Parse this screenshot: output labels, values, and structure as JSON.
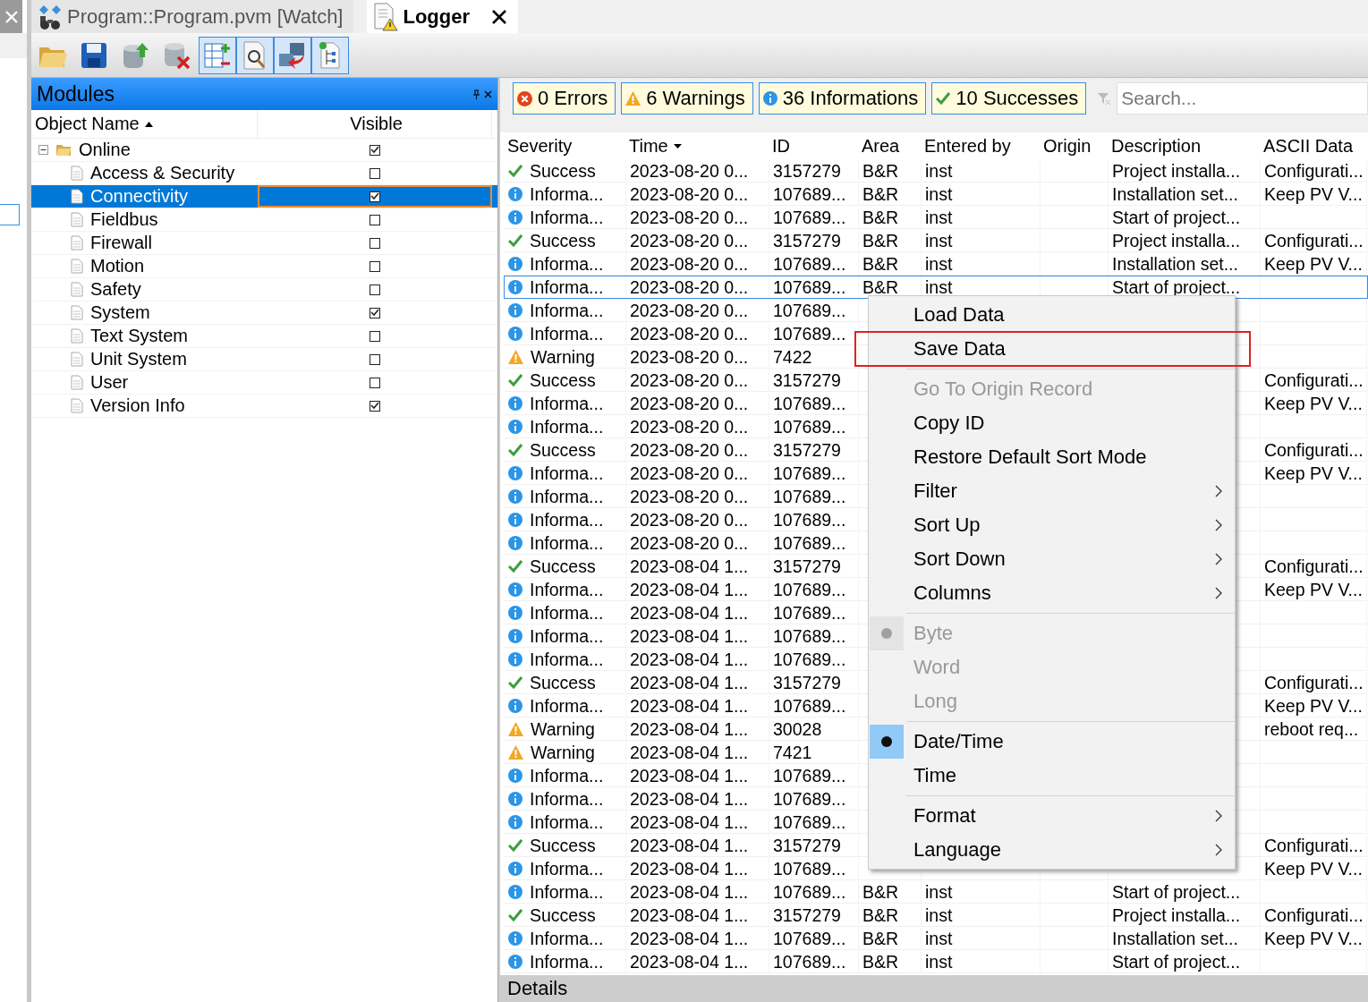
{
  "tabs": [
    {
      "label": "Program::Program.pvm [Watch]",
      "kind": "watch",
      "selected": false
    },
    {
      "label": "Logger",
      "kind": "logger",
      "selected": true
    }
  ],
  "toolbar": [
    {
      "kind": "open",
      "pressed": false
    },
    {
      "kind": "save",
      "pressed": false
    },
    {
      "kind": "upload",
      "pressed": false
    },
    {
      "kind": "delete",
      "pressed": false
    },
    {
      "kind": "columns",
      "pressed": true
    },
    {
      "kind": "find",
      "pressed": true
    },
    {
      "kind": "transfer",
      "pressed": true
    },
    {
      "kind": "tree",
      "pressed": true
    }
  ],
  "modules": {
    "title": "Modules",
    "columns": [
      "Object Name",
      "Visible"
    ],
    "tree": [
      {
        "name": "Online",
        "visible": true,
        "expanded": true,
        "selected": false,
        "children": [
          {
            "name": "Access & Security",
            "visible": false,
            "selected": false
          },
          {
            "name": "Connectivity",
            "visible": true,
            "selected": true
          },
          {
            "name": "Fieldbus",
            "visible": false,
            "selected": false
          },
          {
            "name": "Firewall",
            "visible": false,
            "selected": false
          },
          {
            "name": "Motion",
            "visible": false,
            "selected": false
          },
          {
            "name": "Safety",
            "visible": false,
            "selected": false
          },
          {
            "name": "System",
            "visible": true,
            "selected": false
          },
          {
            "name": "Text System",
            "visible": false,
            "selected": false
          },
          {
            "name": "Unit System",
            "visible": false,
            "selected": false
          },
          {
            "name": "User",
            "visible": false,
            "selected": false
          },
          {
            "name": "Version Info",
            "visible": true,
            "selected": false
          }
        ]
      }
    ]
  },
  "filters": [
    {
      "kind": "error",
      "label": "0 Errors"
    },
    {
      "kind": "warning",
      "label": "6 Warnings"
    },
    {
      "kind": "info",
      "label": "36 Informations"
    },
    {
      "kind": "success",
      "label": "10 Successes"
    }
  ],
  "search": {
    "placeholder": "Search..."
  },
  "log": {
    "columns": [
      "Severity",
      "Time",
      "ID",
      "Area",
      "Entered by",
      "Origin",
      "Description",
      "ASCII Data"
    ],
    "rows": [
      {
        "kind": "success",
        "severity": "Success",
        "time": "2023-08-20 0...",
        "id": "3157279",
        "area": "B&R",
        "entered_by": "inst",
        "description": "Project installa...",
        "ascii": "Configurati...",
        "selected": false
      },
      {
        "kind": "info",
        "severity": "Informa...",
        "time": "2023-08-20 0...",
        "id": "107689...",
        "area": "B&R",
        "entered_by": "inst",
        "description": "Installation set...",
        "ascii": "Keep PV V...",
        "selected": false
      },
      {
        "kind": "info",
        "severity": "Informa...",
        "time": "2023-08-20 0...",
        "id": "107689...",
        "area": "B&R",
        "entered_by": "inst",
        "description": "Start of project...",
        "selected": false
      },
      {
        "kind": "success",
        "severity": "Success",
        "time": "2023-08-20 0...",
        "id": "3157279",
        "area": "B&R",
        "entered_by": "inst",
        "description": "Project installa...",
        "ascii": "Configurati...",
        "selected": false
      },
      {
        "kind": "info",
        "severity": "Informa...",
        "time": "2023-08-20 0...",
        "id": "107689...",
        "area": "B&R",
        "entered_by": "inst",
        "description": "Installation set...",
        "ascii": "Keep PV V...",
        "selected": false
      },
      {
        "kind": "info",
        "severity": "Informa...",
        "time": "2023-08-20 0...",
        "id": "107689...",
        "area": "B&R",
        "entered_by": "inst",
        "description": "Start of project...",
        "selected": true
      },
      {
        "kind": "info",
        "severity": "Informa...",
        "time": "2023-08-20 0...",
        "id": "107689...",
        "selected": false
      },
      {
        "kind": "info",
        "severity": "Informa...",
        "time": "2023-08-20 0...",
        "id": "107689...",
        "selected": false
      },
      {
        "kind": "warning",
        "severity": "Warning",
        "time": "2023-08-20 0...",
        "id": "7422",
        "selected": false
      },
      {
        "kind": "success",
        "severity": "Success",
        "time": "2023-08-20 0...",
        "id": "3157279",
        "ascii": "Configurati...",
        "selected": false
      },
      {
        "kind": "info",
        "severity": "Informa...",
        "time": "2023-08-20 0...",
        "id": "107689...",
        "ascii": "Keep PV V...",
        "selected": false
      },
      {
        "kind": "info",
        "severity": "Informa...",
        "time": "2023-08-20 0...",
        "id": "107689...",
        "selected": false
      },
      {
        "kind": "success",
        "severity": "Success",
        "time": "2023-08-20 0...",
        "id": "3157279",
        "ascii": "Configurati...",
        "selected": false
      },
      {
        "kind": "info",
        "severity": "Informa...",
        "time": "2023-08-20 0...",
        "id": "107689...",
        "ascii": "Keep PV V...",
        "selected": false
      },
      {
        "kind": "info",
        "severity": "Informa...",
        "time": "2023-08-20 0...",
        "id": "107689...",
        "selected": false
      },
      {
        "kind": "info",
        "severity": "Informa...",
        "time": "2023-08-20 0...",
        "id": "107689...",
        "selected": false
      },
      {
        "kind": "info",
        "severity": "Informa...",
        "time": "2023-08-20 0...",
        "id": "107689...",
        "selected": false
      },
      {
        "kind": "success",
        "severity": "Success",
        "time": "2023-08-04 1...",
        "id": "3157279",
        "ascii": "Configurati...",
        "selected": false
      },
      {
        "kind": "info",
        "severity": "Informa...",
        "time": "2023-08-04 1...",
        "id": "107689...",
        "ascii": "Keep PV V...",
        "selected": false
      },
      {
        "kind": "info",
        "severity": "Informa...",
        "time": "2023-08-04 1...",
        "id": "107689...",
        "selected": false
      },
      {
        "kind": "info",
        "severity": "Informa...",
        "time": "2023-08-04 1...",
        "id": "107689...",
        "selected": false
      },
      {
        "kind": "info",
        "severity": "Informa...",
        "time": "2023-08-04 1...",
        "id": "107689...",
        "selected": false
      },
      {
        "kind": "success",
        "severity": "Success",
        "time": "2023-08-04 1...",
        "id": "3157279",
        "ascii": "Configurati...",
        "selected": false
      },
      {
        "kind": "info",
        "severity": "Informa...",
        "time": "2023-08-04 1...",
        "id": "107689...",
        "ascii": "Keep PV V...",
        "selected": false
      },
      {
        "kind": "warning",
        "severity": "Warning",
        "time": "2023-08-04 1...",
        "id": "30028",
        "ascii": "reboot req...",
        "selected": false
      },
      {
        "kind": "warning",
        "severity": "Warning",
        "time": "2023-08-04 1...",
        "id": "7421",
        "selected": false
      },
      {
        "kind": "info",
        "severity": "Informa...",
        "time": "2023-08-04 1...",
        "id": "107689...",
        "selected": false
      },
      {
        "kind": "info",
        "severity": "Informa...",
        "time": "2023-08-04 1...",
        "id": "107689...",
        "selected": false
      },
      {
        "kind": "info",
        "severity": "Informa...",
        "time": "2023-08-04 1...",
        "id": "107689...",
        "selected": false
      },
      {
        "kind": "success",
        "severity": "Success",
        "time": "2023-08-04 1...",
        "id": "3157279",
        "ascii": "Configurati...",
        "selected": false
      },
      {
        "kind": "info",
        "severity": "Informa...",
        "time": "2023-08-04 1...",
        "id": "107689...",
        "ascii": "Keep PV V...",
        "selected": false
      },
      {
        "kind": "info",
        "severity": "Informa...",
        "time": "2023-08-04 1...",
        "id": "107689...",
        "area": "B&R",
        "entered_by": "inst",
        "description": "Start of project...",
        "selected": false
      },
      {
        "kind": "success",
        "severity": "Success",
        "time": "2023-08-04 1...",
        "id": "3157279",
        "area": "B&R",
        "entered_by": "inst",
        "description": "Project installa...",
        "ascii": "Configurati...",
        "selected": false
      },
      {
        "kind": "info",
        "severity": "Informa...",
        "time": "2023-08-04 1...",
        "id": "107689...",
        "area": "B&R",
        "entered_by": "inst",
        "description": "Installation set...",
        "ascii": "Keep PV V...",
        "selected": false
      },
      {
        "kind": "info",
        "severity": "Informa...",
        "time": "2023-08-04 1...",
        "id": "107689...",
        "area": "B&R",
        "entered_by": "inst",
        "description": "Start of project...",
        "selected": false
      }
    ]
  },
  "context_menu": [
    {
      "kind": "item",
      "label": "Load Data",
      "disabled": false
    },
    {
      "kind": "item",
      "label": "Save Data",
      "disabled": false,
      "highlighted": true
    },
    {
      "kind": "separator"
    },
    {
      "kind": "item",
      "label": "Go To Origin Record",
      "disabled": true
    },
    {
      "kind": "item",
      "label": "Copy ID",
      "disabled": false
    },
    {
      "kind": "item",
      "label": "Restore Default Sort Mode",
      "disabled": false
    },
    {
      "kind": "submenu",
      "label": "Filter",
      "disabled": false
    },
    {
      "kind": "submenu",
      "label": "Sort Up",
      "disabled": false
    },
    {
      "kind": "submenu",
      "label": "Sort Down",
      "disabled": false
    },
    {
      "kind": "submenu",
      "label": "Columns",
      "disabled": false
    },
    {
      "kind": "separator"
    },
    {
      "kind": "radio",
      "label": "Byte",
      "disabled": true,
      "selected": true
    },
    {
      "kind": "radio",
      "label": "Word",
      "disabled": true,
      "selected": false
    },
    {
      "kind": "radio",
      "label": "Long",
      "disabled": true,
      "selected": false
    },
    {
      "kind": "separator"
    },
    {
      "kind": "radio",
      "label": "Date/Time",
      "disabled": false,
      "selected": true
    },
    {
      "kind": "radio",
      "label": "Time",
      "disabled": false,
      "selected": false
    },
    {
      "kind": "separator"
    },
    {
      "kind": "submenu",
      "label": "Format",
      "disabled": false
    },
    {
      "kind": "submenu",
      "label": "Language",
      "disabled": false
    }
  ],
  "details": {
    "title": "Details"
  }
}
